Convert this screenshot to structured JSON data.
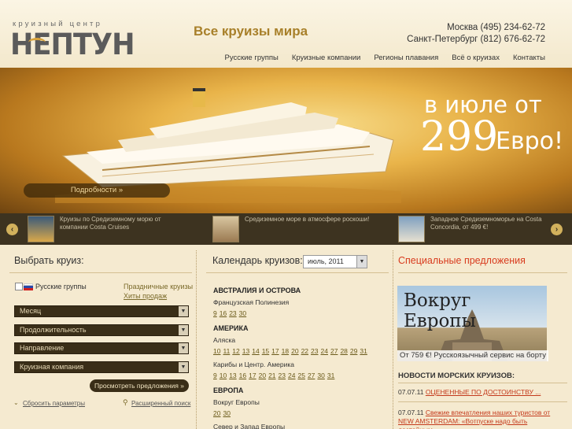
{
  "header": {
    "logo_small": "круизный центр",
    "logo_big": "НЕПТУН",
    "tagline": "Все круизы мира",
    "phone_moscow": "Москва (495) 234-62-72",
    "phone_spb": "Санкт-Петербург (812) 676-62-72",
    "nav": [
      "Русские группы",
      "Круизные компании",
      "Регионы плавания",
      "Всё о круизах",
      "Контакты"
    ]
  },
  "banner": {
    "promo_line1": "в июле от",
    "promo_price": "299",
    "promo_currency": "Евро!",
    "details_button": "Подробности »"
  },
  "strip": {
    "items": [
      "Круизы по Средиземному морю от компании Costa Cruises",
      "Средиземное море в атмосфере роскоши!",
      "Западное Средиземноморье на Costa Concordia, от 499 €!"
    ],
    "prev": "‹",
    "next": "›"
  },
  "left": {
    "title": "Выбрать круиз:",
    "russian_groups": "Русские группы",
    "holiday_cruises": "Праздничные круизы",
    "hits": "Хиты продаж",
    "selects": [
      "Месяц",
      "Продолжительность",
      "Направление",
      "Круизная компания"
    ],
    "view_button": "Просмотреть предложения »",
    "reset": "Сбросить параметры",
    "advanced": "Расширенный поиск"
  },
  "calendar": {
    "title": "Календарь круизов:",
    "selected_month": "июль, 2011",
    "regions": [
      {
        "name": "АВСТРАЛИЯ И ОСТРОВА",
        "subs": [
          {
            "name": "Французская Полинезия",
            "dates": [
              "9",
              "16",
              "23",
              "30"
            ]
          }
        ]
      },
      {
        "name": "АМЕРИКА",
        "subs": [
          {
            "name": "Аляска",
            "dates": [
              "10",
              "11",
              "12",
              "13",
              "14",
              "15",
              "17",
              "18",
              "20",
              "22",
              "23",
              "24",
              "27",
              "28",
              "29",
              "31"
            ]
          },
          {
            "name": "Карибы и Центр. Америка",
            "dates": [
              "9",
              "10",
              "13",
              "16",
              "17",
              "20",
              "21",
              "23",
              "24",
              "25",
              "27",
              "30",
              "31"
            ]
          }
        ]
      },
      {
        "name": "ЕВРОПА",
        "subs": [
          {
            "name": "Вокруг Европы",
            "dates": [
              "20",
              "30"
            ]
          },
          {
            "name": "Север и Запад Европы",
            "dates": []
          }
        ]
      }
    ]
  },
  "right": {
    "title": "Специальные предложения",
    "promo_img_title": "Вокруг Европы",
    "promo_caption": "От 759 €! Русскоязычный сервис на борту",
    "news_title": "НОВОСТИ МОРСКИХ КРУИЗОВ:",
    "news": [
      {
        "date": "07.07.11",
        "text": "ОЦЕНЕННЫЕ ПО ДОСТОИНСТВУ ..."
      },
      {
        "date": "07.07.11",
        "text": "Свежие впечатления наших туристов от NEW AMSTERDAM: «Вотпуске надо быть достойным»"
      }
    ]
  },
  "colors": {
    "accent_gold": "#a8802a",
    "red_title": "#d83b1e",
    "dark_button": "#3a2e18"
  }
}
